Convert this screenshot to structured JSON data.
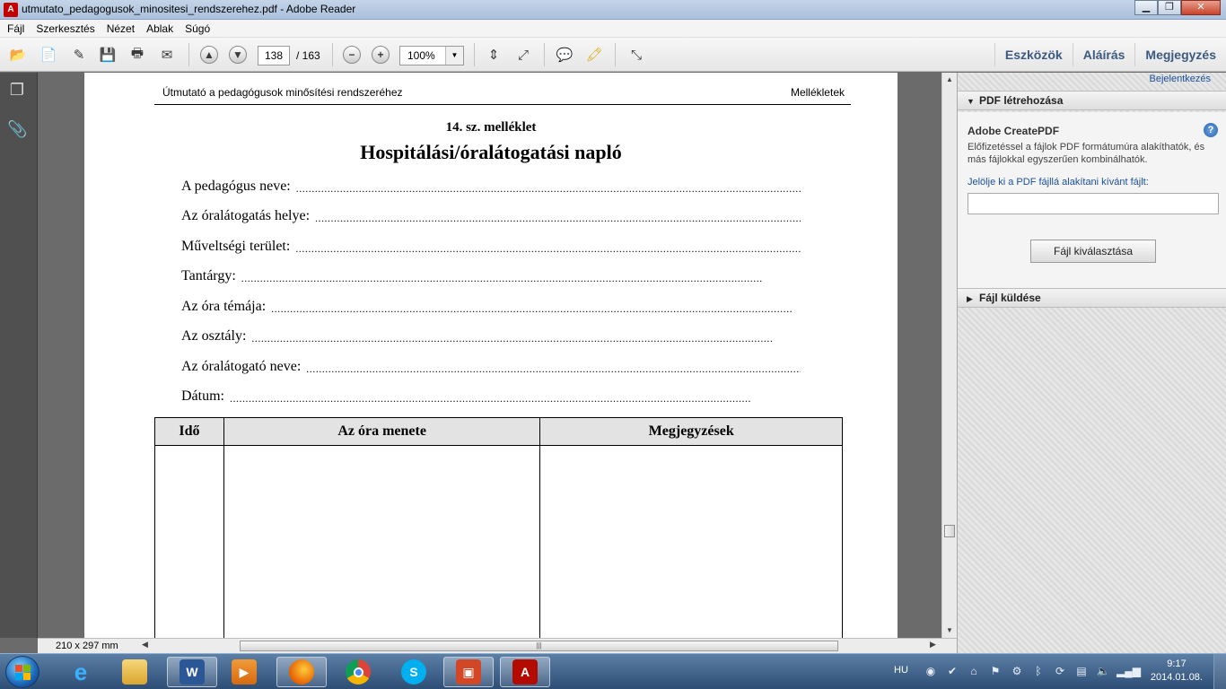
{
  "window": {
    "title": "utmutato_pedagogusok_minositesi_rendszerehez.pdf - Adobe Reader",
    "minimize": "▁",
    "maximize": "❐",
    "close": "✕"
  },
  "menu": [
    "Fájl",
    "Szerkesztés",
    "Nézet",
    "Ablak",
    "Súgó"
  ],
  "toolbar": {
    "page_current": "138",
    "page_total": "/ 163",
    "zoom": "100%",
    "tabs": [
      "Eszközök",
      "Aláírás",
      "Megjegyzés"
    ]
  },
  "document": {
    "header_left": "Útmutató a pedagógusok minősítési rendszeréhez",
    "header_right": "Mellékletek",
    "annex": "14. sz. melléklet",
    "title": "Hospitálási/óralátogatási napló",
    "fields": [
      "A pedagógus neve:",
      "Az óralátogatás helye:",
      "Műveltségi terület:",
      "Tantárgy:",
      "Az óra témája:",
      "Az osztály:",
      "Az óralátogató neve:",
      "Dátum:"
    ],
    "dots": "......................................................................................................................................................................",
    "table_headers": [
      "Idő",
      "Az óra menete",
      "Megjegyzések"
    ]
  },
  "status": {
    "page_size": "210 x 297 mm"
  },
  "right_panel": {
    "login": "Bejelentkezés",
    "section_create": "PDF létrehozása",
    "createpdf_title": "Adobe CreatePDF",
    "createpdf_desc": "Előfizetéssel a fájlok PDF formátumúra alakíthatók, és más fájlokkal egyszerűen kombinálhatók.",
    "createpdf_prompt": "Jelölje ki a PDF fájllá alakítani kívánt fájlt:",
    "select_file_button": "Fájl kiválasztása",
    "section_send": "Fájl küldése"
  },
  "taskbar": {
    "apps": [
      "Internet Explorer",
      "Windows Explorer",
      "Microsoft Word",
      "Media Player",
      "Firefox",
      "Chrome",
      "Skype",
      "Presentation app",
      "Adobe Reader"
    ],
    "language": "HU",
    "time": "9:17",
    "date": "2014.01.08."
  },
  "colors": {
    "accent_tab": "#3c5a80",
    "link_blue": "#1b4f9a",
    "adobe_red": "#c40000"
  }
}
